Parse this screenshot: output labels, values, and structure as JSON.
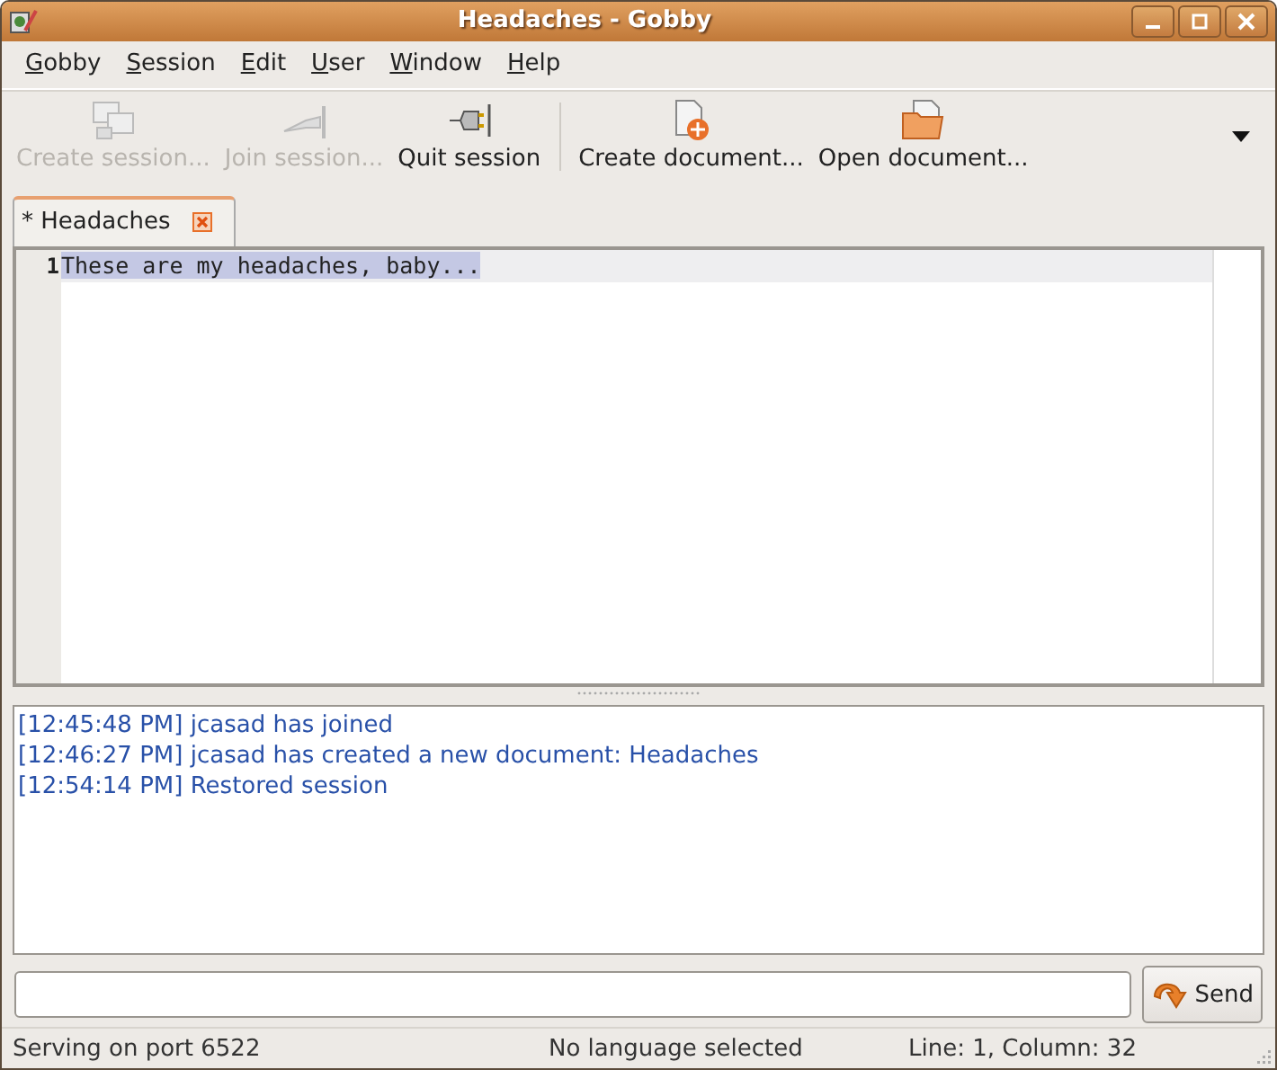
{
  "window": {
    "title": "Headaches - Gobby"
  },
  "menu": [
    "Gobby",
    "Session",
    "Edit",
    "User",
    "Window",
    "Help"
  ],
  "toolbar": [
    {
      "label": "Create session...",
      "disabled": true
    },
    {
      "label": "Join session...",
      "disabled": true
    },
    {
      "label": "Quit session",
      "disabled": false
    },
    {
      "label": "Create document...",
      "disabled": false
    },
    {
      "label": "Open document...",
      "disabled": false
    }
  ],
  "tabs": [
    {
      "label": "* Headaches",
      "selected": true
    }
  ],
  "editor": {
    "lines": [
      {
        "number": "1",
        "text": "These are my headaches, baby...",
        "selected": true
      }
    ]
  },
  "chat": [
    "[12:45:48 PM] jcasad has joined",
    "[12:46:27 PM] jcasad has created a new document: Headaches",
    "[12:54:14 PM] Restored session"
  ],
  "send_button": "Send",
  "status_bar": [
    "Serving on port 6522",
    "No language selected",
    "Line: 1, Column: 32"
  ]
}
